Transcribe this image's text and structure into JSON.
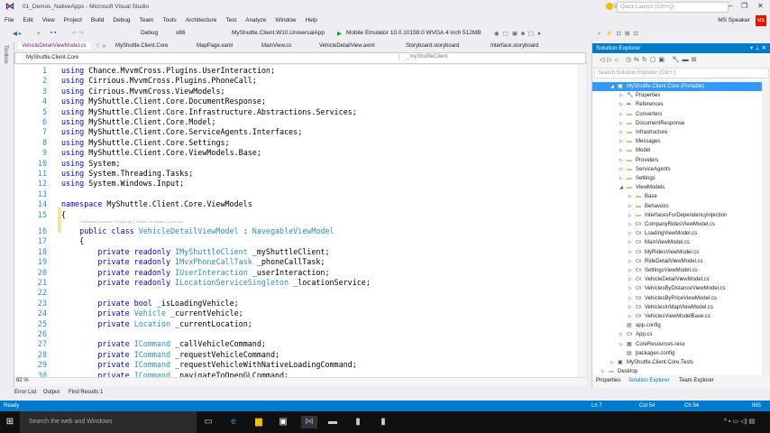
{
  "window": {
    "title": "01_Demos_NativeApps - Microsoft Visual Studio",
    "quick_launch": "Quick Launch (Ctrl+Q)",
    "user": "MS Speaker",
    "avatar": "MS"
  },
  "menu": [
    "File",
    "Edit",
    "View",
    "Project",
    "Build",
    "Debug",
    "Team",
    "Tools",
    "Architecture",
    "Test",
    "Analyze",
    "Window",
    "Help"
  ],
  "toolbar": {
    "config": "Debug",
    "platform": "x86",
    "startup": "MyShuttle.Client.W10.UniversalApp",
    "run_target": "Mobile Emulator 10.0.10159.0 WVGA 4 inch 512MB"
  },
  "toolbox": "Toolbox",
  "tabs": [
    "VehicleDetailViewModel.cs",
    "MyShuttle.Client.Core",
    "MapPage.xaml",
    "MainView.cs",
    "VehicleDetailView.axml",
    "Storyboard.storyboard",
    "Interface.storyboard"
  ],
  "navbar": {
    "project": "MyShuttle.Client.Core",
    "class": "MyShuttle.Client.Core.ViewModels.VehicleDetailViewModel",
    "member": "_myShuttleClient"
  },
  "codelens": "0 references | unknown, 214 days ago | 1 author, 16 changes | 1 work item",
  "code": [
    [
      [
        "using ",
        "kw"
      ],
      [
        "Chance.MvvmCross.Plugins.UserInteraction;",
        "tx"
      ]
    ],
    [
      [
        "using ",
        "kw"
      ],
      [
        "Cirrious.MvvmCross.Plugins.PhoneCall;",
        "tx"
      ]
    ],
    [
      [
        "using ",
        "kw"
      ],
      [
        "Cirrious.MvvmCross.ViewModels;",
        "tx"
      ]
    ],
    [
      [
        "using ",
        "kw"
      ],
      [
        "MyShuttle.Client.Core.DocumentResponse;",
        "tx"
      ]
    ],
    [
      [
        "using ",
        "kw"
      ],
      [
        "MyShuttle.Client.Core.Infrastructure.Abstractions.Services;",
        "tx"
      ]
    ],
    [
      [
        "using ",
        "kw"
      ],
      [
        "MyShuttle.Client.Core.Model;",
        "tx"
      ]
    ],
    [
      [
        "using ",
        "kw"
      ],
      [
        "MyShuttle.Client.Core.ServiceAgents.Interfaces;",
        "tx"
      ]
    ],
    [
      [
        "using ",
        "kw"
      ],
      [
        "MyShuttle.Client.Core.Settings;",
        "tx"
      ]
    ],
    [
      [
        "using ",
        "kw"
      ],
      [
        "MyShuttle.Client.Core.ViewModels.Base;",
        "tx"
      ]
    ],
    [
      [
        "using ",
        "kw"
      ],
      [
        "System;",
        "tx"
      ]
    ],
    [
      [
        "using ",
        "kw"
      ],
      [
        "System.Threading.Tasks;",
        "tx"
      ]
    ],
    [
      [
        "using ",
        "kw"
      ],
      [
        "System.Windows.Input;",
        "tx"
      ]
    ],
    [],
    [
      [
        "namespace ",
        "kw"
      ],
      [
        "MyShuttle.Client.Core.ViewModels",
        "tx"
      ]
    ],
    [
      [
        "{",
        "tx"
      ]
    ],
    [
      [
        "    public class ",
        "kw"
      ],
      [
        "VehicleDetailViewModel",
        "ty"
      ],
      [
        " : ",
        "tx"
      ],
      [
        "NavegableViewModel",
        "ty"
      ]
    ],
    [
      [
        "    {",
        "tx"
      ]
    ],
    [
      [
        "        private readonly ",
        "kw"
      ],
      [
        "IMyShuttleClient",
        "ty"
      ],
      [
        " _myShuttleClient;",
        "tx"
      ]
    ],
    [
      [
        "        private readonly ",
        "kw"
      ],
      [
        "IMvxPhoneCallTask",
        "ty"
      ],
      [
        " _phoneCallTask;",
        "tx"
      ]
    ],
    [
      [
        "        private readonly ",
        "kw"
      ],
      [
        "IUserInteraction",
        "ty"
      ],
      [
        " _userInteraction;",
        "tx"
      ]
    ],
    [
      [
        "        private readonly ",
        "kw"
      ],
      [
        "ILocationServiceSingleton",
        "ty"
      ],
      [
        " _locationService;",
        "tx"
      ]
    ],
    [],
    [
      [
        "        private bool ",
        "kw"
      ],
      [
        "_isLoadingVehicle;",
        "tx"
      ]
    ],
    [
      [
        "        private ",
        "kw"
      ],
      [
        "Vehicle",
        "ty"
      ],
      [
        " _currentVehicle;",
        "tx"
      ]
    ],
    [
      [
        "        private ",
        "kw"
      ],
      [
        "Location",
        "ty"
      ],
      [
        " _currentLocation;",
        "tx"
      ]
    ],
    [],
    [
      [
        "        private ",
        "kw"
      ],
      [
        "ICommand",
        "ty"
      ],
      [
        " _callVehicleCommand;",
        "tx"
      ]
    ],
    [
      [
        "        private ",
        "kw"
      ],
      [
        "ICommand",
        "ty"
      ],
      [
        " _requestVehicleCommand;",
        "tx"
      ]
    ],
    [
      [
        "        private ",
        "kw"
      ],
      [
        "ICommand",
        "ty"
      ],
      [
        " _requestVehicleWithNativeLoadingCommand;",
        "tx"
      ]
    ],
    [
      [
        "        private ",
        "kw"
      ],
      [
        "ICommand",
        "ty"
      ],
      [
        " _navigateToOpenGLCommand;",
        "tx"
      ]
    ]
  ],
  "editor": {
    "zoom": "82 %"
  },
  "bottom_tabs": [
    "Error List",
    "Output",
    "Find Results 1"
  ],
  "solution_explorer": {
    "title": "Solution Explorer",
    "search_placeholder": "Search Solution Explorer (Ctrl+;)",
    "tree": [
      {
        "label": "MyShuttle.Client.Core (Portable)",
        "depth": 0,
        "type": "project",
        "arrow": "open"
      },
      {
        "label": "Properties",
        "depth": 1,
        "type": "props",
        "arrow": "closed"
      },
      {
        "label": "References",
        "depth": 1,
        "type": "refs",
        "arrow": "closed"
      },
      {
        "label": "Converters",
        "depth": 1,
        "type": "folder",
        "arrow": "closed"
      },
      {
        "label": "DocumentResponse",
        "depth": 1,
        "type": "folder",
        "arrow": "closed"
      },
      {
        "label": "Infrastructure",
        "depth": 1,
        "type": "folder",
        "arrow": "closed"
      },
      {
        "label": "Messages",
        "depth": 1,
        "type": "folder",
        "arrow": "closed"
      },
      {
        "label": "Model",
        "depth": 1,
        "type": "folder",
        "arrow": "closed"
      },
      {
        "label": "Providers",
        "depth": 1,
        "type": "folder",
        "arrow": "closed"
      },
      {
        "label": "ServiceAgents",
        "depth": 1,
        "type": "folder",
        "arrow": "closed"
      },
      {
        "label": "Settings",
        "depth": 1,
        "type": "folder",
        "arrow": "closed"
      },
      {
        "label": "ViewModels",
        "depth": 1,
        "type": "folder",
        "arrow": "open"
      },
      {
        "label": "Base",
        "depth": 2,
        "type": "folder",
        "arrow": "closed"
      },
      {
        "label": "Behavoirs",
        "depth": 2,
        "type": "folder",
        "arrow": "closed"
      },
      {
        "label": "InterfacesForDependencyInjection",
        "depth": 2,
        "type": "folder",
        "arrow": "closed"
      },
      {
        "label": "CompanyRidesViewModel.cs",
        "depth": 2,
        "type": "cs",
        "arrow": "closed"
      },
      {
        "label": "LoadingViewModel.cs",
        "depth": 2,
        "type": "cs",
        "arrow": "closed"
      },
      {
        "label": "MainViewModel.cs",
        "depth": 2,
        "type": "cs",
        "arrow": "closed"
      },
      {
        "label": "MyRidesViewModel.cs",
        "depth": 2,
        "type": "cs",
        "arrow": "closed"
      },
      {
        "label": "RideDetailViewModel.cs",
        "depth": 2,
        "type": "cs",
        "arrow": "closed"
      },
      {
        "label": "SettingsViewModel.cs",
        "depth": 2,
        "type": "cs",
        "arrow": "closed"
      },
      {
        "label": "VehicleDetailViewModel.cs",
        "depth": 2,
        "type": "cs",
        "arrow": "closed"
      },
      {
        "label": "VehiclesByDistanceViewModel.cs",
        "depth": 2,
        "type": "cs",
        "arrow": "closed"
      },
      {
        "label": "VehiclesByPriceViewModel.cs",
        "depth": 2,
        "type": "cs",
        "arrow": "closed"
      },
      {
        "label": "VehiclesInMapViewModel.cs",
        "depth": 2,
        "type": "cs",
        "arrow": "closed"
      },
      {
        "label": "VehiclesViewModelBase.cs",
        "depth": 2,
        "type": "cs",
        "arrow": "closed"
      },
      {
        "label": "app.config",
        "depth": 1,
        "type": "config",
        "arrow": "none"
      },
      {
        "label": "App.cs",
        "depth": 1,
        "type": "cs",
        "arrow": "closed"
      },
      {
        "label": "CoreResources.resx",
        "depth": 1,
        "type": "resx",
        "arrow": "closed"
      },
      {
        "label": "packages.config",
        "depth": 1,
        "type": "config",
        "arrow": "none"
      },
      {
        "label": "MyShuttle.Client.Core.Tests",
        "depth": 0,
        "type": "project",
        "arrow": "closed"
      },
      {
        "label": "Desktop",
        "depth": -1,
        "type": "folder",
        "arrow": "closed"
      }
    ],
    "tabs": [
      "Properties",
      "Solution Explorer",
      "Team Explorer"
    ]
  },
  "status": {
    "text": "Ready",
    "ln": "Ln 7",
    "col": "Col 54",
    "ch": "Ch 54",
    "mode": "INS"
  },
  "taskbar": {
    "search": "Search the web and Windows"
  },
  "colors": {
    "accent": "#007acc",
    "vs_purple": "#68217a",
    "keyword": "#0000ff",
    "type": "#2b91af"
  }
}
